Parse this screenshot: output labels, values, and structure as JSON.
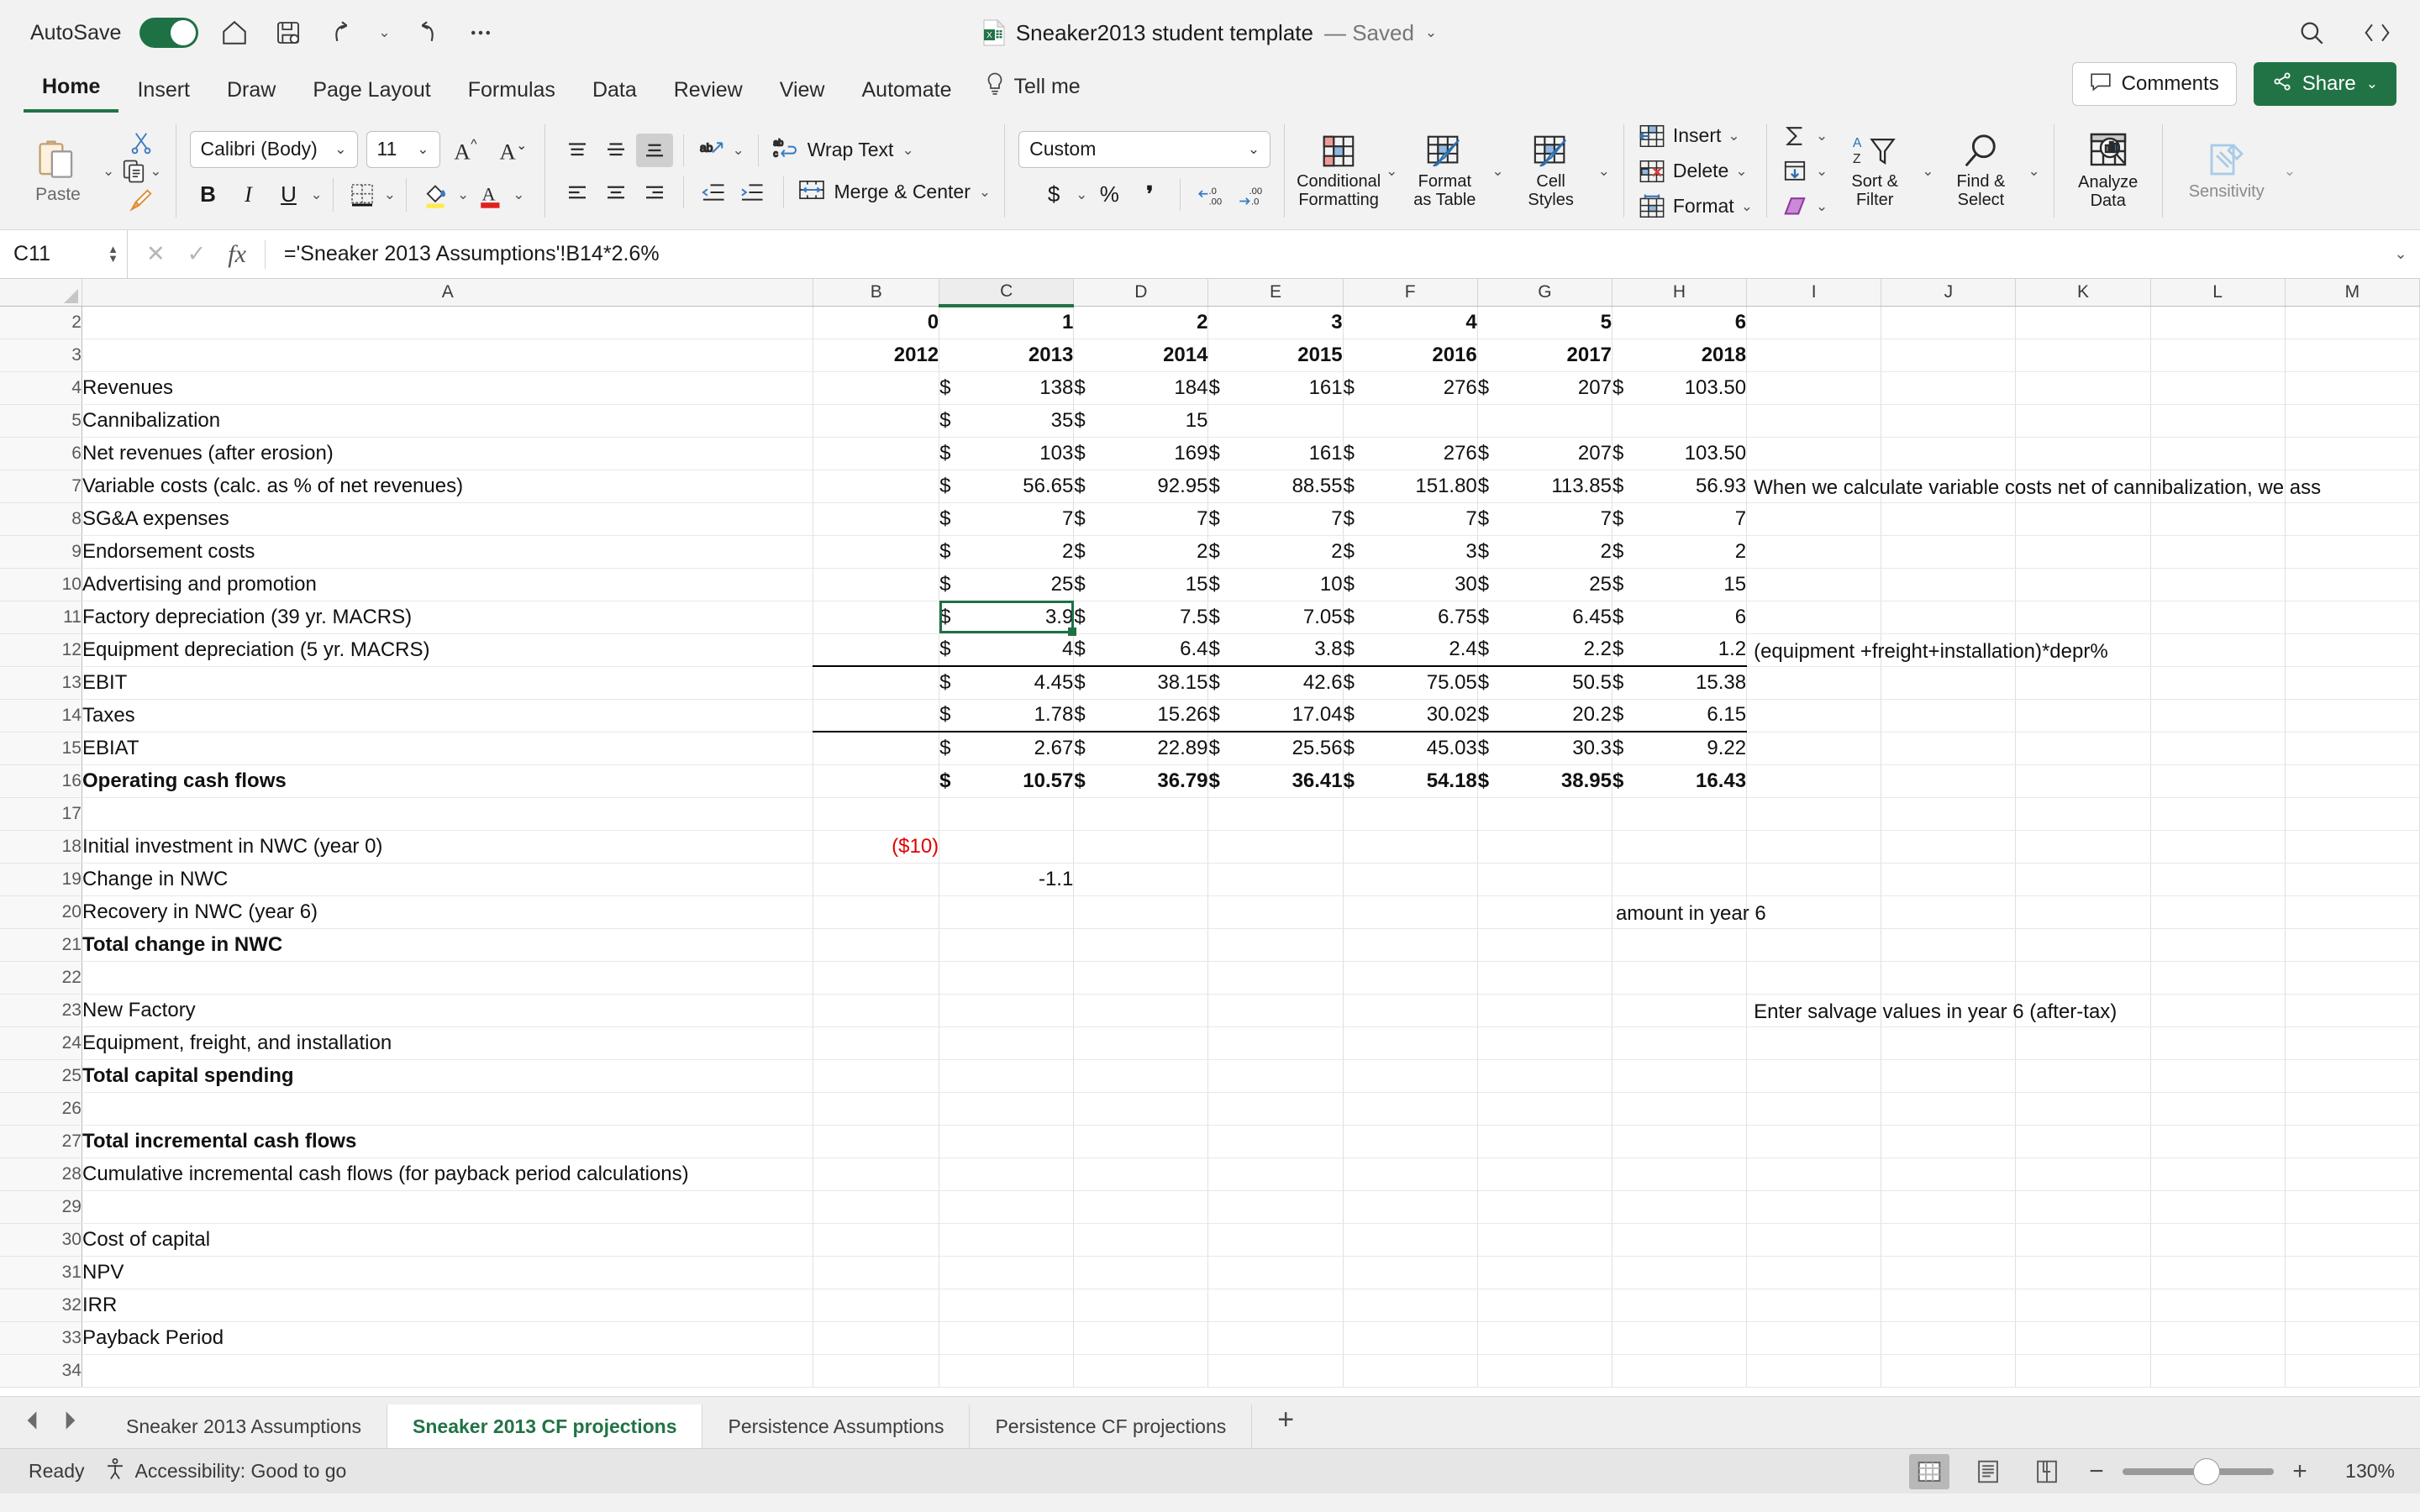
{
  "titlebar": {
    "autosave_label": "AutoSave",
    "autosave_on": true,
    "doc_title": "Sneaker2013 student template",
    "doc_status": "— Saved",
    "quick_access": [
      "home-icon",
      "save-icon",
      "undo-icon",
      "undo-dropdown",
      "redo-icon",
      "more-icon"
    ],
    "right_icons": [
      "search-icon",
      "ribbon-display-icon"
    ]
  },
  "ribbon_tabs": {
    "tabs": [
      {
        "label": "Home",
        "active": true
      },
      {
        "label": "Insert",
        "active": false
      },
      {
        "label": "Draw",
        "active": false
      },
      {
        "label": "Page Layout",
        "active": false
      },
      {
        "label": "Formulas",
        "active": false
      },
      {
        "label": "Data",
        "active": false
      },
      {
        "label": "Review",
        "active": false
      },
      {
        "label": "View",
        "active": false
      },
      {
        "label": "Automate",
        "active": false
      }
    ],
    "tell_me": "Tell me",
    "comments_label": "Comments",
    "share_label": "Share"
  },
  "ribbon": {
    "clipboard": {
      "paste_label": "Paste",
      "cut": "scissors-icon",
      "copy": "copy-icon",
      "format_painter": "format-painter-icon"
    },
    "font": {
      "family_value": "Calibri (Body)",
      "size_value": "11",
      "grow_label": "A",
      "shrink_label": "A",
      "bold": "B",
      "italic": "I",
      "underline": "U"
    },
    "alignment": {
      "wrap_text": "Wrap Text",
      "merge_center": "Merge & Center"
    },
    "number": {
      "format_value": "Custom"
    },
    "styles": {
      "conditional_formatting": "Conditional\nFormatting",
      "conditional_formatting_l1": "Conditional",
      "conditional_formatting_l2": "Formatting",
      "format_as_table_l1": "Format",
      "format_as_table_l2": "as Table",
      "cell_styles_l1": "Cell",
      "cell_styles_l2": "Styles"
    },
    "cells": {
      "insert": "Insert",
      "delete": "Delete",
      "format": "Format"
    },
    "editing": {
      "sort_filter_l1": "Sort &",
      "sort_filter_l2": "Filter",
      "find_select_l1": "Find &",
      "find_select_l2": "Select"
    },
    "analyze": {
      "l1": "Analyze",
      "l2": "Data"
    },
    "sensitivity": {
      "label": "Sensitivity"
    }
  },
  "formula_bar": {
    "name_box": "C11",
    "cancel_icon": "cancel-icon",
    "confirm_icon": "confirm-icon",
    "fx_icon": "fx-icon",
    "formula": "='Sneaker 2013 Assumptions'!B14*2.6%"
  },
  "grid": {
    "columns": [
      "A",
      "B",
      "C",
      "D",
      "E",
      "F",
      "G",
      "H",
      "I",
      "J",
      "K",
      "L",
      "M"
    ],
    "selected_column": "C",
    "selected_cell": "C11",
    "rows": [
      {
        "n": "2",
        "A": "",
        "B": "0",
        "C": "1",
        "D": "2",
        "E": "3",
        "F": "4",
        "G": "5",
        "H": "6",
        "bold": true,
        "align": "rgt",
        "money": false
      },
      {
        "n": "3",
        "A": "",
        "B": "2012",
        "C": "2013",
        "D": "2014",
        "E": "2015",
        "F": "2016",
        "G": "2017",
        "H": "2018",
        "bold": true,
        "align": "rgt",
        "money": false
      },
      {
        "n": "4",
        "A": "Revenues",
        "B": "",
        "C": "138",
        "D": "184",
        "E": "161",
        "F": "276",
        "G": "207",
        "H": "103.50",
        "money": true
      },
      {
        "n": "5",
        "A": "Cannibalization",
        "B": "",
        "C": "35",
        "D": "15",
        "E": "",
        "F": "",
        "G": "",
        "H": "",
        "money": true
      },
      {
        "n": "6",
        "A": "Net revenues (after erosion)",
        "B": "",
        "C": "103",
        "D": "169",
        "E": "161",
        "F": "276",
        "G": "207",
        "H": "103.50",
        "money": true
      },
      {
        "n": "7",
        "A": "Variable costs (calc. as % of net revenues)",
        "B": "",
        "C": "56.65",
        "D": "92.95",
        "E": "88.55",
        "F": "151.80",
        "G": "113.85",
        "H": "56.93",
        "money": true,
        "note": "When we calculate variable costs net of cannibalization, we ass"
      },
      {
        "n": "8",
        "A": "SG&A expenses",
        "B": "",
        "C": "7",
        "D": "7",
        "E": "7",
        "F": "7",
        "G": "7",
        "H": "7",
        "money": true
      },
      {
        "n": "9",
        "A": "Endorsement costs",
        "B": "",
        "C": "2",
        "D": "2",
        "E": "2",
        "F": "3",
        "G": "2",
        "H": "2",
        "money": true
      },
      {
        "n": "10",
        "A": "Advertising and promotion",
        "B": "",
        "C": "25",
        "D": "15",
        "E": "10",
        "F": "30",
        "G": "25",
        "H": "15",
        "money": true
      },
      {
        "n": "11",
        "A": "Factory depreciation (39 yr. MACRS)",
        "B": "",
        "C": "3.9",
        "D": "7.5",
        "E": "7.05",
        "F": "6.75",
        "G": "6.45",
        "H": "6",
        "money": true
      },
      {
        "n": "12",
        "A": "Equipment depreciation (5 yr. MACRS)",
        "B": "",
        "C": "4",
        "D": "6.4",
        "E": "3.8",
        "F": "2.4",
        "G": "2.2",
        "H": "1.2",
        "money": true,
        "note": "(equipment +freight+installation)*depr%"
      },
      {
        "n": "13",
        "A": "EBIT",
        "B": "",
        "C": "4.45",
        "D": "38.15",
        "E": "42.6",
        "F": "75.05",
        "G": "50.5",
        "H": "15.38",
        "money": true,
        "topline": true
      },
      {
        "n": "14",
        "A": "Taxes",
        "B": "",
        "C": "1.78",
        "D": "15.26",
        "E": "17.04",
        "F": "30.02",
        "G": "20.2",
        "H": "6.15",
        "money": true
      },
      {
        "n": "15",
        "A": "EBIAT",
        "B": "",
        "C": "2.67",
        "D": "22.89",
        "E": "25.56",
        "F": "45.03",
        "G": "30.3",
        "H": "9.22",
        "money": true,
        "topline": true
      },
      {
        "n": "16",
        "A": "Operating cash flows",
        "B": "",
        "C": "10.57",
        "D": "36.79",
        "E": "36.41",
        "F": "54.18",
        "G": "38.95",
        "H": "16.43",
        "money": true,
        "bold": true
      },
      {
        "n": "17",
        "A": "",
        "B": "",
        "C": "",
        "D": "",
        "E": "",
        "F": "",
        "G": "",
        "H": ""
      },
      {
        "n": "18",
        "A": "Initial investment in NWC (year 0)",
        "B": "($10)",
        "C": "",
        "D": "",
        "E": "",
        "F": "",
        "G": "",
        "H": "",
        "align": "rgt",
        "red_b": true
      },
      {
        "n": "19",
        "A": "Change in NWC",
        "B": "",
        "C": "-1.1",
        "D": "",
        "E": "",
        "F": "",
        "G": "",
        "H": "",
        "align": "rgt"
      },
      {
        "n": "20",
        "A": "Recovery in NWC (year 6)",
        "B": "",
        "C": "",
        "D": "",
        "E": "",
        "F": "",
        "G": "",
        "H": "",
        "note_h": "amount in year 6"
      },
      {
        "n": "21",
        "A": "Total change in NWC",
        "B": "",
        "C": "",
        "D": "",
        "E": "",
        "F": "",
        "G": "",
        "H": "",
        "bold": true
      },
      {
        "n": "22",
        "A": "",
        "B": "",
        "C": "",
        "D": "",
        "E": "",
        "F": "",
        "G": "",
        "H": ""
      },
      {
        "n": "23",
        "A": "New Factory",
        "B": "",
        "C": "",
        "D": "",
        "E": "",
        "F": "",
        "G": "",
        "H": "",
        "note": "Enter salvage values in year 6 (after-tax)"
      },
      {
        "n": "24",
        "A": "Equipment, freight, and installation",
        "B": "",
        "C": "",
        "D": "",
        "E": "",
        "F": "",
        "G": "",
        "H": ""
      },
      {
        "n": "25",
        "A": "Total capital spending",
        "B": "",
        "C": "",
        "D": "",
        "E": "",
        "F": "",
        "G": "",
        "H": "",
        "bold": true
      },
      {
        "n": "26",
        "A": "",
        "B": "",
        "C": "",
        "D": "",
        "E": "",
        "F": "",
        "G": "",
        "H": ""
      },
      {
        "n": "27",
        "A": "Total incremental cash flows",
        "B": "",
        "C": "",
        "D": "",
        "E": "",
        "F": "",
        "G": "",
        "H": "",
        "bold": true
      },
      {
        "n": "28",
        "A": "Cumulative incremental cash flows (for payback period calculations)",
        "B": "",
        "C": "",
        "D": "",
        "E": "",
        "F": "",
        "G": "",
        "H": ""
      },
      {
        "n": "29",
        "A": "",
        "B": "",
        "C": "",
        "D": "",
        "E": "",
        "F": "",
        "G": "",
        "H": ""
      },
      {
        "n": "30",
        "A": "Cost of capital",
        "B": "",
        "C": "",
        "D": "",
        "E": "",
        "F": "",
        "G": "",
        "H": ""
      },
      {
        "n": "31",
        "A": "NPV",
        "B": "",
        "C": "",
        "D": "",
        "E": "",
        "F": "",
        "G": "",
        "H": ""
      },
      {
        "n": "32",
        "A": "IRR",
        "B": "",
        "C": "",
        "D": "",
        "E": "",
        "F": "",
        "G": "",
        "H": ""
      },
      {
        "n": "33",
        "A": "Payback Period",
        "B": "",
        "C": "",
        "D": "",
        "E": "",
        "F": "",
        "G": "",
        "H": ""
      },
      {
        "n": "34",
        "A": "",
        "B": "",
        "C": "",
        "D": "",
        "E": "",
        "F": "",
        "G": "",
        "H": ""
      }
    ]
  },
  "sheet_tabs": {
    "tabs": [
      {
        "label": "Sneaker 2013 Assumptions",
        "active": false
      },
      {
        "label": "Sneaker 2013 CF projections",
        "active": true
      },
      {
        "label": "Persistence Assumptions",
        "active": false
      },
      {
        "label": "Persistence CF projections",
        "active": false
      }
    ],
    "add_label": "+"
  },
  "status_bar": {
    "ready": "Ready",
    "accessibility": "Accessibility: Good to go",
    "views": [
      "normal-view-icon",
      "page-layout-icon",
      "page-break-icon"
    ],
    "zoom_minus": "−",
    "zoom_plus": "+",
    "zoom_value": "130%"
  },
  "colors": {
    "excel_green": "#217346",
    "selection_green": "#1e7145",
    "negative_red": "#e00000"
  }
}
